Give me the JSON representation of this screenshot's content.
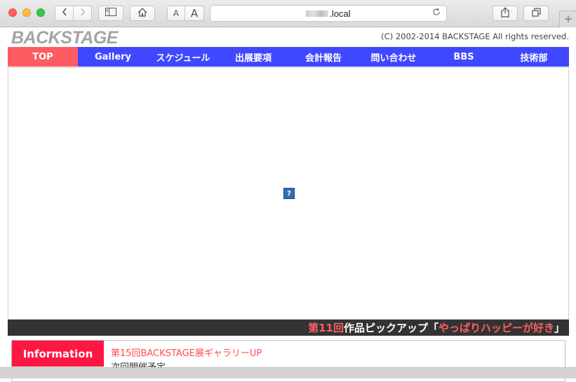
{
  "browser": {
    "url_host": ".local",
    "font_small": "A",
    "font_large": "A"
  },
  "site": {
    "logo": "BACKSTAGE",
    "copyright": "(C)  2002-2014 BACKSTAGE All rights reserved."
  },
  "nav": {
    "items": [
      {
        "label": "TOP"
      },
      {
        "label": "Gallery"
      },
      {
        "label": "スケジュール"
      },
      {
        "label": "出展要項"
      },
      {
        "label": "会計報告"
      },
      {
        "label": "問い合わせ"
      },
      {
        "label": "BBS"
      },
      {
        "label": "技術部"
      }
    ],
    "active_color": "#ff5b63",
    "bar_color": "#3f48ff"
  },
  "stage": {
    "broken_image_glyph": "?"
  },
  "pickup": {
    "part1": "第11回",
    "part2": "作品ピックアップ「",
    "part3": "やっぱりハッピーが好き",
    "part4": "」"
  },
  "information": {
    "label": "Information",
    "items": [
      "第15回BACKSTAGE展ギャラリーUP",
      "次回開催予定"
    ]
  }
}
